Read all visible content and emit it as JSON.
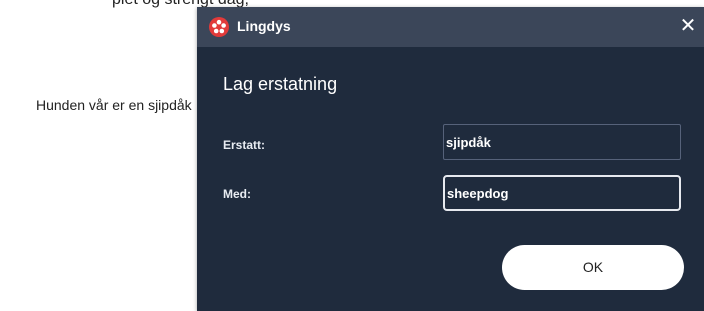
{
  "background": {
    "top_text_fragment": "plet og strengt dag,",
    "body_text": "Hunden vår er en sjipdåk"
  },
  "dialog": {
    "app_title": "Lingdys",
    "heading": "Lag erstatning",
    "close_symbol": "✕",
    "replace_label": "Erstatt:",
    "replace_value": "sjipdåk",
    "with_label": "Med:",
    "with_value": "sheepdog",
    "ok_label": "OK"
  },
  "colors": {
    "dialog_bg": "#1f2b3d",
    "titlebar_bg": "#3b4659",
    "logo_red": "#e23a3a",
    "button_bg": "#ffffff"
  },
  "icons": {
    "logo": "lingdys-flower-icon",
    "close": "close-icon"
  }
}
